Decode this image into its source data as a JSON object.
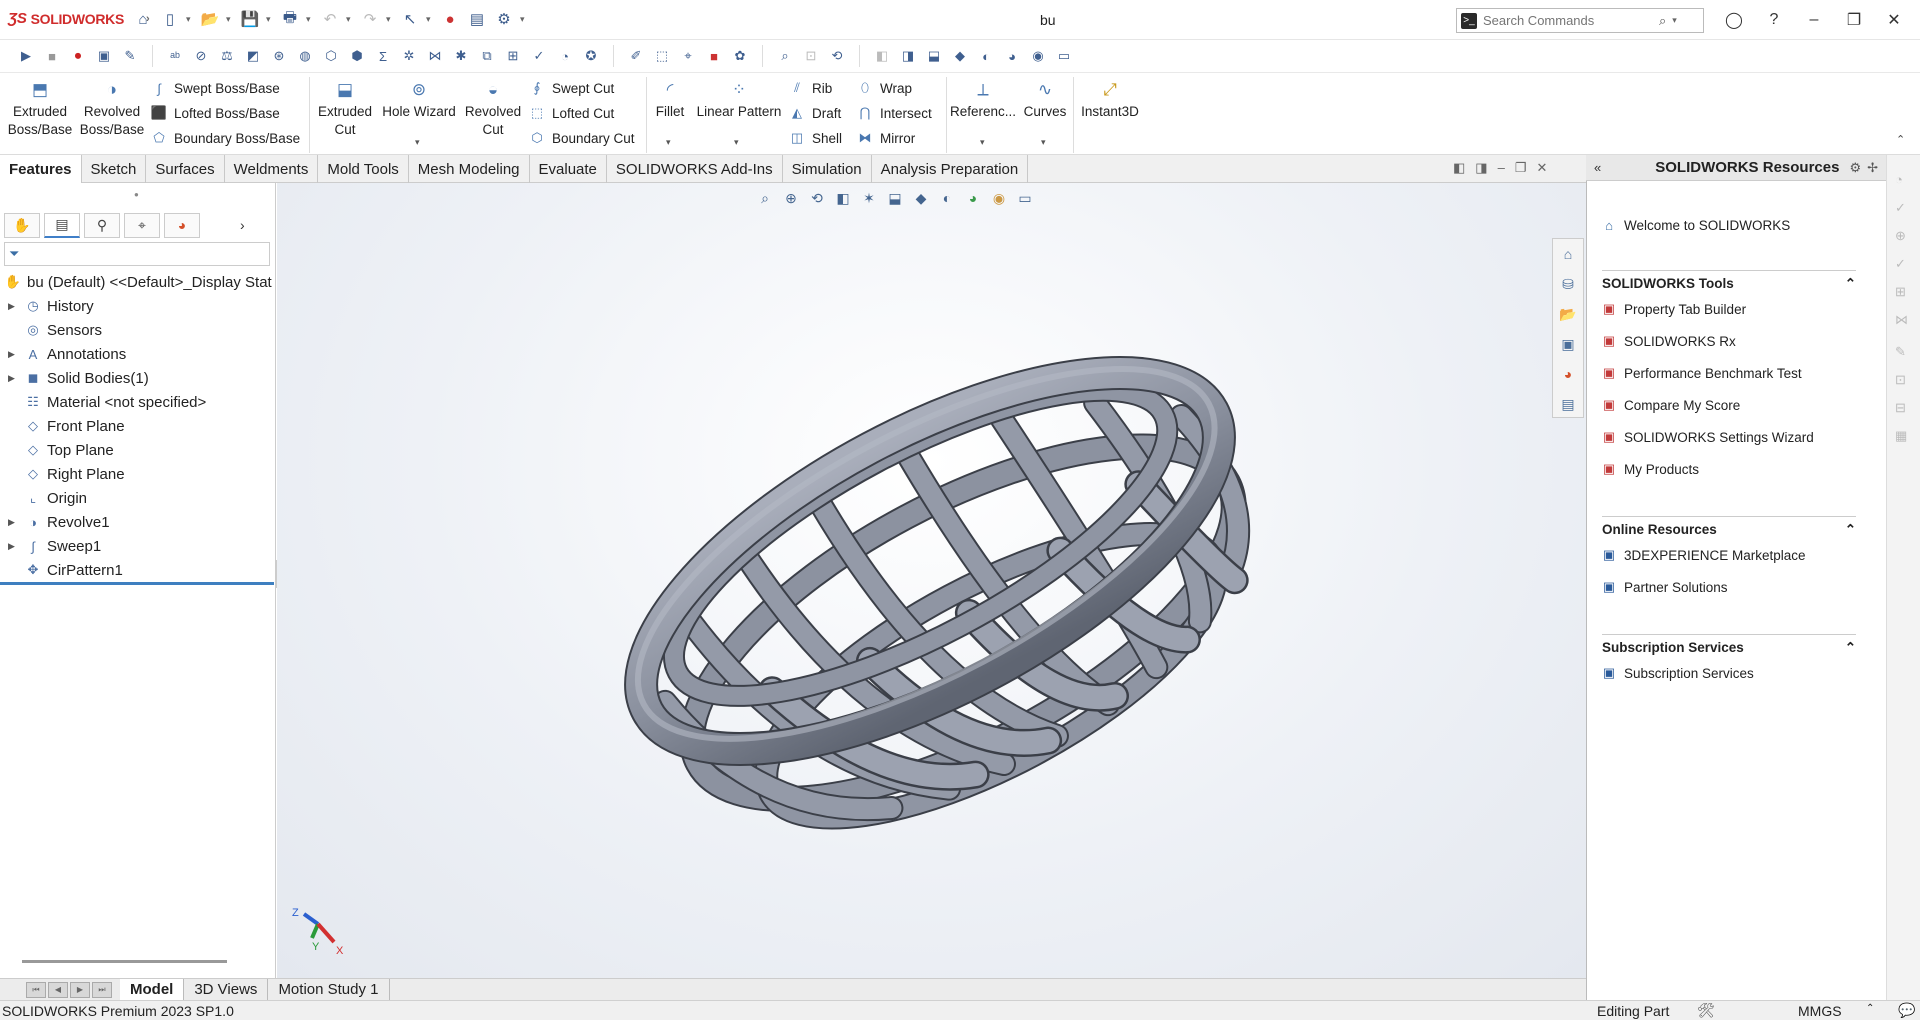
{
  "app": {
    "brand": "SOLIDWORKS",
    "doc_title": "bu"
  },
  "search": {
    "placeholder": "Search Commands"
  },
  "ribbon": {
    "extruded_boss": "Extruded Boss/Base",
    "revolved_boss": "Revolved Boss/Base",
    "swept_boss": "Swept Boss/Base",
    "lofted_boss": "Lofted Boss/Base",
    "boundary_boss": "Boundary Boss/Base",
    "extruded_cut": "Extruded Cut",
    "hole_wizard": "Hole Wizard",
    "revolved_cut": "Revolved Cut",
    "swept_cut": "Swept Cut",
    "lofted_cut": "Lofted Cut",
    "boundary_cut": "Boundary Cut",
    "fillet": "Fillet",
    "linear_pattern": "Linear Pattern",
    "rib": "Rib",
    "draft": "Draft",
    "shell": "Shell",
    "wrap": "Wrap",
    "intersect": "Intersect",
    "mirror": "Mirror",
    "reference": "Referenc...",
    "curves": "Curves",
    "instant3d": "Instant3D"
  },
  "tabs": [
    "Features",
    "Sketch",
    "Surfaces",
    "Weldments",
    "Mold Tools",
    "Mesh Modeling",
    "Evaluate",
    "SOLIDWORKS Add-Ins",
    "Simulation",
    "Analysis Preparation"
  ],
  "tree": {
    "root": "bu (Default) <<Default>_Display Stat",
    "items": [
      {
        "label": "History",
        "expandable": true,
        "icon": "history-icon"
      },
      {
        "label": "Sensors",
        "expandable": false,
        "icon": "sensor-icon"
      },
      {
        "label": "Annotations",
        "expandable": true,
        "icon": "annotation-icon"
      },
      {
        "label": "Solid Bodies(1)",
        "expandable": true,
        "icon": "solid-body-icon"
      },
      {
        "label": "Material <not specified>",
        "expandable": false,
        "icon": "material-icon"
      },
      {
        "label": "Front Plane",
        "expandable": false,
        "icon": "plane-icon"
      },
      {
        "label": "Top Plane",
        "expandable": false,
        "icon": "plane-icon"
      },
      {
        "label": "Right Plane",
        "expandable": false,
        "icon": "plane-icon"
      },
      {
        "label": "Origin",
        "expandable": false,
        "icon": "origin-icon"
      },
      {
        "label": "Revolve1",
        "expandable": true,
        "icon": "revolve-icon"
      },
      {
        "label": "Sweep1",
        "expandable": true,
        "icon": "sweep-icon"
      },
      {
        "label": "CirPattern1",
        "expandable": false,
        "icon": "circular-pattern-icon"
      }
    ]
  },
  "resources": {
    "title": "SOLIDWORKS Resources",
    "welcome": "Welcome to SOLIDWORKS",
    "tools_header": "SOLIDWORKS Tools",
    "tools": [
      "Property Tab Builder",
      "SOLIDWORKS Rx",
      "Performance Benchmark Test",
      "Compare My Score",
      "SOLIDWORKS Settings Wizard",
      "My Products"
    ],
    "online_header": "Online Resources",
    "online": [
      "3DEXPERIENCE Marketplace",
      "Partner Solutions"
    ],
    "subs_header": "Subscription Services",
    "subs": [
      "Subscription Services"
    ]
  },
  "bottom_tabs": [
    "Model",
    "3D Views",
    "Motion Study 1"
  ],
  "status": {
    "version": "SOLIDWORKS Premium 2023 SP1.0",
    "mode": "Editing Part",
    "units": "MMGS"
  },
  "triad": {
    "x": "X",
    "y": "Y",
    "z": "Z"
  },
  "colors": {
    "brand_red": "#d02c2c",
    "model_gray": "#8a909e",
    "selection_blue": "#3e7fc0"
  }
}
